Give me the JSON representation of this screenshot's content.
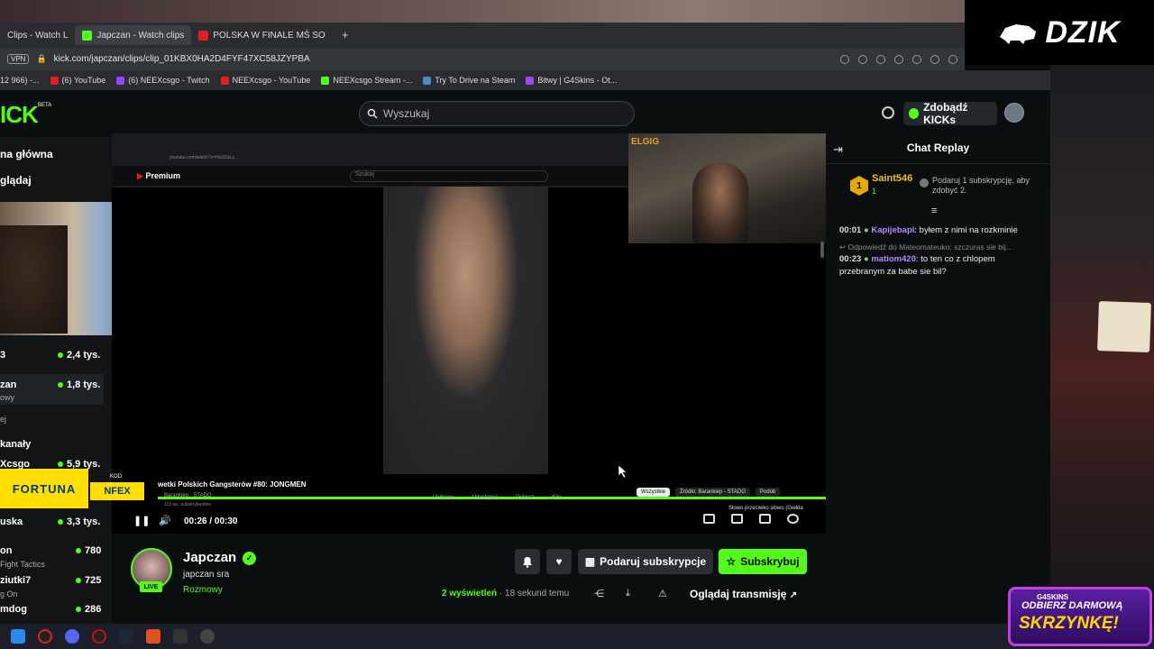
{
  "browser": {
    "tabs": [
      {
        "label": "Clips - Watch L",
        "color": "#3a3a3a"
      },
      {
        "label": "Japczan - Watch clips",
        "color": "#53fc18"
      },
      {
        "label": "POLSKA W FINALE MŚ SO",
        "color": "#e02020"
      }
    ],
    "add_tab": "+",
    "vpn": "VPN",
    "url": "kick.com/japczan/clips/clip_01KBX0HA2D4FYF47XC58JZYPBA",
    "bookmarks": [
      {
        "label": "12 966) -...",
        "color": "#888"
      },
      {
        "label": "(6) YouTube",
        "color": "#e02020"
      },
      {
        "label": "(6) NEEXcsgo - Twitch",
        "color": "#9146ff"
      },
      {
        "label": "NEEXcsgo - YouTube",
        "color": "#e02020"
      },
      {
        "label": "NEEXcsgo Stream -...",
        "color": "#53fc18"
      },
      {
        "label": "Try To Drive na Steam",
        "color": "#4a8ac8"
      },
      {
        "label": "Bitwy | G4Skins - Ot...",
        "color": "#9a4af0"
      }
    ]
  },
  "overlay": {
    "dzik": "DZIK",
    "fortuna": "FORTUNA",
    "code_label": "KOD:",
    "code": "NFEX",
    "g4_brand": "G4SKINS",
    "g4_line1": "ODBIERZ DARMOWĄ",
    "g4_line2": "SKRZYNKĘ!",
    "elgig": "ELGIG"
  },
  "kick": {
    "logo": "ICK",
    "beta": "BETA",
    "search_placeholder": "Wyszukaj",
    "kicks_button": "Zdobądź KICKs"
  },
  "sidebar": {
    "home": "na główna",
    "browse": "glądaj",
    "channels": [
      {
        "name": "3",
        "sub": "",
        "count": "2,4 tys."
      },
      {
        "name": "zan",
        "sub": "owy",
        "count": "1,8 tys."
      },
      {
        "name": "",
        "sub": "ej",
        "count": ""
      }
    ],
    "section_label": "kanały",
    "more": [
      {
        "name": "Xcsgo",
        "sub": "",
        "count": "5,9 tys."
      },
      {
        "name": "uska",
        "sub": "",
        "count": "3,3 tys."
      },
      {
        "name": "on",
        "sub": "Fight Tactics",
        "count": "780"
      },
      {
        "name": "ziutki7",
        "sub": "g On",
        "count": "725"
      },
      {
        "name": "mdog",
        "sub": "",
        "count": "286"
      }
    ]
  },
  "video": {
    "yt_logo": "Premium",
    "yt_search": "Szukaj",
    "yt_url": "youtube.com/watch?v=HaS2aLz...",
    "yt_title": "wetki Polskich Gangsterów #80: JONGMEN",
    "yt_channel": "Barankiep · STADO",
    "yt_subs": "115 tys. subskrybentów",
    "yt_actions": [
      "Ulubione",
      "Udostępnij",
      "Pobierz",
      "Klip"
    ],
    "chips": [
      "Wszystkie",
      "Źródło: Barankiep - STADO",
      "Podob"
    ],
    "chip_active": "Wszystkie",
    "side_video": "Słowo przeciwko słowu (Giełda",
    "time": "00:26 / 00:30",
    "progress": 0.87
  },
  "chat": {
    "title": "Chat Replay",
    "pinned": {
      "rank": "1",
      "user": "Saint546",
      "count": "1",
      "text": "Podaruj 1 subskrypcję, aby zdobyć 2."
    },
    "messages": [
      {
        "time": "00:01",
        "user": "Kapijebapi",
        "text": ": byłem z nimi na rozkminie"
      },
      {
        "time": "00:23",
        "user": "matiom420",
        "text": ": to ten co z chlopem przebranym za babe sie bil?"
      }
    ],
    "reply": "Odpowiedź do Mateomateuko: szczuras sie bij..."
  },
  "channel": {
    "name": "Japczan",
    "title": "japczan sra",
    "category": "Rozmowy",
    "live": "LIVE",
    "gift_button": "Podaruj subskrypcje",
    "sub_button": "Subskrybuj",
    "views": "2 wyświetleń",
    "ago": " · 18 sekund temu",
    "watch_stream": "Oglądaj transmisję"
  }
}
